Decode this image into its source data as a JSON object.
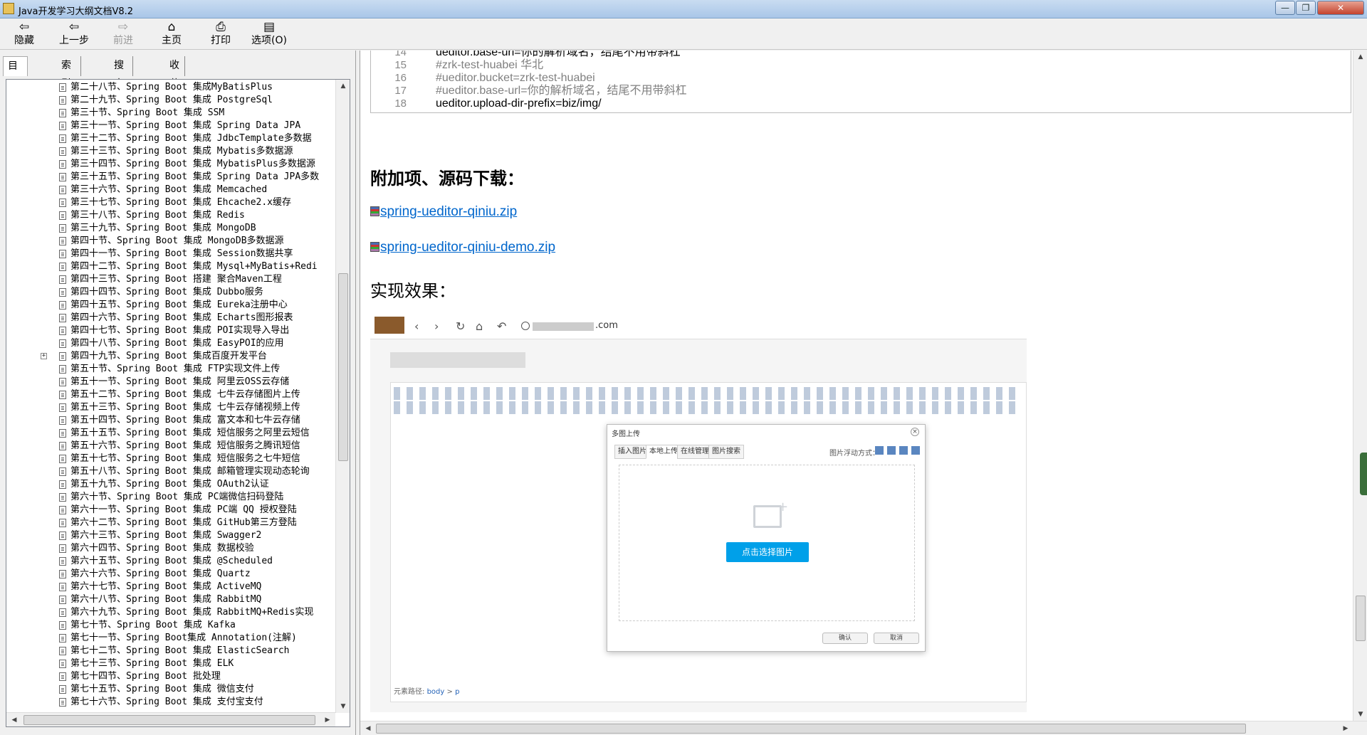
{
  "window": {
    "title": "Java开发学习大纲文档V8.2",
    "min": "—",
    "max": "❐",
    "close": "✕"
  },
  "toolbar": [
    {
      "icon": "⇦",
      "label": "隐藏"
    },
    {
      "icon": "⇦",
      "label": "上一步"
    },
    {
      "icon": "⇨",
      "label": "前进"
    },
    {
      "icon": "⌂",
      "label": "主页"
    },
    {
      "icon": "⎙",
      "label": "打印"
    },
    {
      "icon": "▤",
      "label": "选项(O)"
    }
  ],
  "left_tabs": [
    "目录(C)",
    "索引(N)",
    "搜索(S)",
    "收藏夹(I)"
  ],
  "tree": [
    "第二十八节、Spring Boot 集成MyBatisPlus",
    "第二十九节、Spring Boot 集成 PostgreSql",
    "第三十节、Spring Boot 集成 SSM",
    "第三十一节、Spring Boot 集成 Spring Data JPA",
    "第三十二节、Spring Boot 集成 JdbcTemplate多数据",
    "第三十三节、Spring Boot 集成 Mybatis多数据源",
    "第三十四节、Spring Boot 集成 MybatisPlus多数据源",
    "第三十五节、Spring Boot 集成 Spring Data JPA多数",
    "第三十六节、Spring Boot 集成 Memcached",
    "第三十七节、Spring Boot 集成 Ehcache2.x缓存",
    "第三十八节、Spring Boot 集成 Redis",
    "第三十九节、Spring Boot 集成 MongoDB",
    "第四十节、Spring Boot 集成 MongoDB多数据源",
    "第四十一节、Spring Boot 集成 Session数据共享",
    "第四十二节、Spring Boot 集成 Mysql+MyBatis+Redi",
    "第四十三节、Spring Boot 搭建 聚合Maven工程",
    "第四十四节、Spring Boot 集成 Dubbo服务",
    "第四十五节、Spring Boot 集成 Eureka注册中心",
    "第四十六节、Spring Boot 集成 Echarts图形报表",
    "第四十七节、Spring Boot 集成 POI实现导入导出",
    "第四十八节、Spring Boot 集成 EasyPOI的应用",
    "第四十九节、Spring Boot 集成百度开发平台",
    "第五十节、Spring Boot 集成 FTP实现文件上传",
    "第五十一节、Spring Boot 集成 阿里云OSS云存储",
    "第五十二节、Spring Boot 集成 七牛云存储图片上传",
    "第五十三节、Spring Boot 集成 七牛云存储视频上传",
    "第五十四节、Spring Boot 集成 富文本和七牛云存储",
    "第五十五节、Spring Boot 集成 短信服务之阿里云短信",
    "第五十六节、Spring Boot 集成 短信服务之腾讯短信",
    "第五十七节、Spring Boot 集成 短信服务之七牛短信",
    "第五十八节、Spring Boot 集成 邮箱管理实现动态轮询",
    "第五十九节、Spring Boot 集成 OAuth2认证",
    "第六十节、Spring Boot 集成 PC端微信扫码登陆",
    "第六十一节、Spring Boot 集成 PC端 QQ 授权登陆",
    "第六十二节、Spring Boot 集成 GitHub第三方登陆",
    "第六十三节、Spring Boot 集成 Swagger2",
    "第六十四节、Spring Boot 集成 数据校验",
    "第六十五节、Spring Boot 集成 @Scheduled",
    "第六十六节、Spring Boot 集成 Quartz",
    "第六十七节、Spring Boot 集成 ActiveMQ",
    "第六十八节、Spring Boot 集成 RabbitMQ",
    "第六十九节、Spring Boot 集成 RabbitMQ+Redis实现",
    "第七十节、Spring Boot 集成 Kafka",
    "第七十一节、Spring Boot集成 Annotation(注解)",
    "第七十二节、Spring Boot 集成 ElasticSearch",
    "第七十三节、Spring Boot 集成 ELK",
    "第七十四节、Spring Boot 批处理",
    "第七十五节、Spring Boot 集成 微信支付",
    "第七十六节、Spring Boot 集成 支付宝支付"
  ],
  "code_lines": [
    {
      "ln": "14",
      "text": "ueditor.base-url=你的解析域名，结尾不用带斜杠",
      "kind": "normal"
    },
    {
      "ln": "15",
      "text": "#zrk-test-huabei 华北",
      "kind": "comment"
    },
    {
      "ln": "16",
      "text": "#ueditor.bucket=zrk-test-huabei",
      "kind": "comment"
    },
    {
      "ln": "17",
      "text": "#ueditor.base-url=你的解析域名，结尾不用带斜杠",
      "kind": "comment"
    },
    {
      "ln": "18",
      "text": "ueditor.upload-dir-prefix=biz/img/",
      "kind": "normal"
    }
  ],
  "section_heading": "附加项、源码下载：",
  "downloads": [
    "spring-ueditor-qiniu.zip",
    "spring-ueditor-qiniu-demo.zip"
  ],
  "result_heading": "实现效果：",
  "screenshot": {
    "url_suffix": ".com",
    "editor_path_label": "元素路径:",
    "editor_path_link1": "body",
    "editor_path_sep": ">",
    "editor_path_link2": "p",
    "dialog_title": "多图上传",
    "dialog_tabs": [
      "插入图片",
      "本地上传",
      "在线管理",
      "图片搜索"
    ],
    "float_label": "图片浮动方式：",
    "pick_button": "点击选择图片",
    "ok": "确认",
    "cancel": "取消"
  }
}
